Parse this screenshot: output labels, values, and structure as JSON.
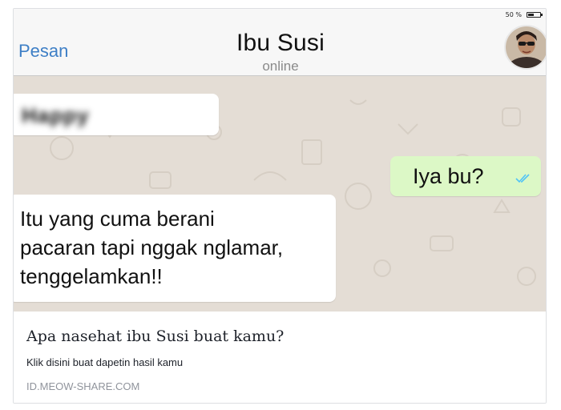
{
  "status_bar": {
    "battery_percent": "50 %",
    "battery_level": 0.5
  },
  "nav": {
    "back_label": "Pesan",
    "contact_name": "Ibu Susi",
    "contact_status": "online"
  },
  "messages": [
    {
      "direction": "incoming",
      "text": "Happy",
      "blurred": true
    },
    {
      "direction": "outgoing",
      "text": "Iya bu?",
      "read_receipt": "double-check-icon"
    },
    {
      "direction": "incoming",
      "text": "Itu yang cuma berani\npacaran tapi nggak nglamar,\ntenggelamkan!!"
    }
  ],
  "link_preview": {
    "title": "Apa nasehat ibu Susi buat kamu?",
    "description": "Klik disini buat dapetin hasil kamu",
    "domain": "ID.MEOW-SHARE.COM"
  },
  "colors": {
    "back_link": "#3e7fc6",
    "outgoing_bubble": "#dcf8c6",
    "incoming_bubble": "#ffffff",
    "wallpaper": "#e4ddd5",
    "read_ticks": "#4fc3f7"
  }
}
